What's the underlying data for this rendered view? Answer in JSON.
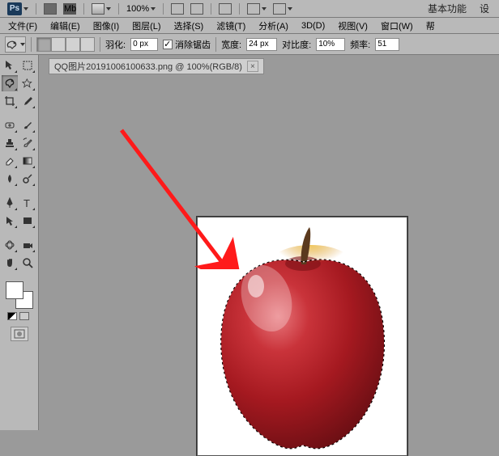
{
  "top": {
    "zoom": "100%",
    "right1": "基本功能",
    "right2": "设"
  },
  "menu": {
    "file": "文件(F)",
    "edit": "编辑(E)",
    "image": "图像(I)",
    "layer": "图层(L)",
    "select": "选择(S)",
    "filter": "滤镜(T)",
    "analysis": "分析(A)",
    "threeD": "3D(D)",
    "view": "视图(V)",
    "window": "窗口(W)",
    "help": "帮"
  },
  "opt": {
    "feather_label": "羽化:",
    "feather_value": "0 px",
    "antialias": "消除锯齿",
    "antialias_on": true,
    "width_label": "宽度:",
    "width_value": "24 px",
    "contrast_label": "对比度:",
    "contrast_value": "10%",
    "freq_label": "频率:",
    "freq_value": "51"
  },
  "doc": {
    "title": "QQ图片20191006100633.png @ 100%(RGB/8)"
  },
  "colors": {
    "apple_body": "#b51d24",
    "apple_high": "#e06a6f",
    "apple_dark": "#6d0f14",
    "apple_top": "#e8b23b",
    "stem": "#5b3a1e",
    "arrow": "#ff1a1a"
  }
}
